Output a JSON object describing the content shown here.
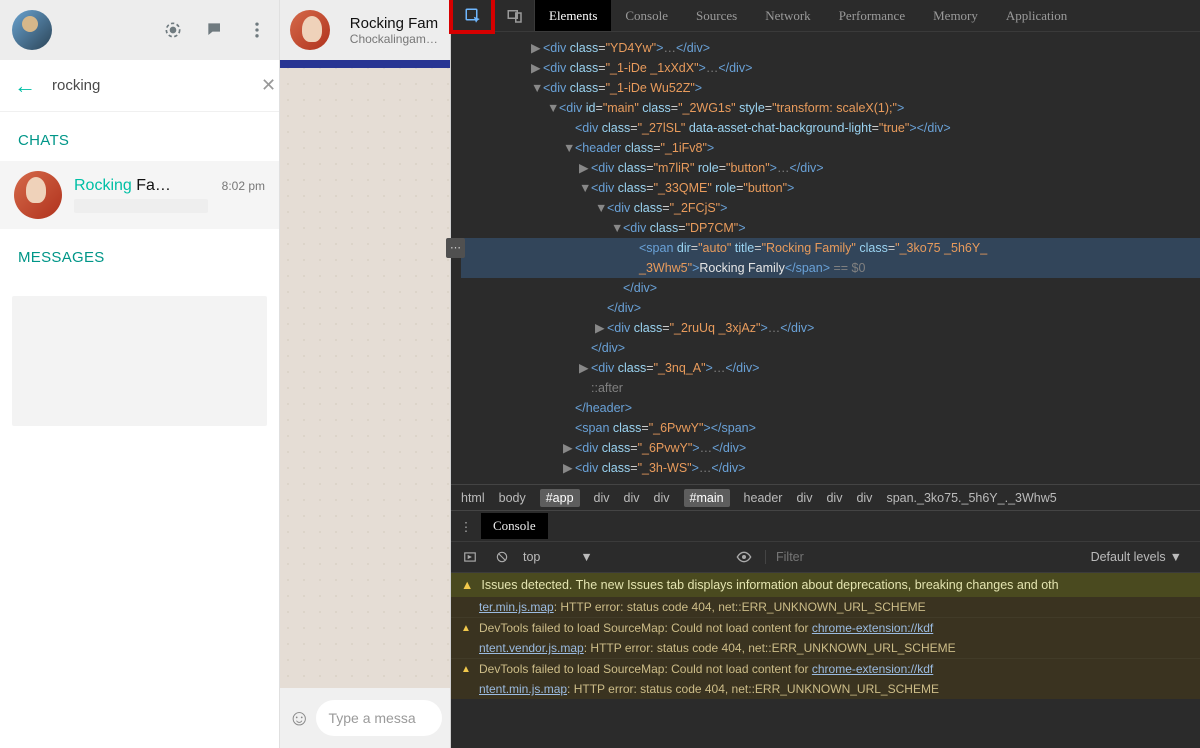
{
  "wa": {
    "search_value": "rocking",
    "section_chats": "CHATS",
    "section_messages": "MESSAGES",
    "chat": {
      "name_hl": "Rocking",
      "name_rest": " Fa…",
      "time": "8:02 pm"
    },
    "main": {
      "title": "Rocking Fam",
      "subtitle": "Chockalingam, B",
      "input_placeholder": "Type a messa"
    }
  },
  "dt": {
    "tabs": [
      "Elements",
      "Console",
      "Sources",
      "Network",
      "Performance",
      "Memory",
      "Application"
    ],
    "active_tab": "Elements",
    "dom": {
      "l1": "▶<div class=\"YD4Yw\">…</div>",
      "l2": "▶<div class=\"_1-iDe _1xXdX\">…</div>",
      "l3": "▼<div class=\"_1-iDe Wu52Z\">",
      "l4": "▼<div id=\"main\" class=\"_2WG1s\" style=\"transform: scaleX(1);\">",
      "l5": "<div class=\"_27lSL\" data-asset-chat-background-light=\"true\"></div>",
      "l6": "▼<header class=\"_1iFv8\">",
      "l7": "▶<div class=\"m7liR\" role=\"button\">…</div>",
      "l8": "▼<div class=\"_33QME\" role=\"button\">",
      "l9": "▼<div class=\"_2FCjS\">",
      "l10": "▼<div class=\"DP7CM\">",
      "l11a": "<span dir=\"auto\" title=\"Rocking Family\" class=\"_3ko75 _5h6Y_",
      "l11b": "_3Whw5\">",
      "l11c": "Rocking Family",
      "l11d": "</span>",
      "l11e": " == $0",
      "l12": "</div>",
      "l13": "</div>",
      "l14": "▶<div class=\"_2ruUq _3xjAz\">…</div>",
      "l15": "</div>",
      "l16": "▶<div class=\"_3nq_A\">…</div>",
      "l17": "::after",
      "l18": "</header>",
      "l19": "<span class=\"_6PvwY\"></span>",
      "l20": "▶<div class=\"_6PvwY\">…</div>",
      "l21": "▶<div class=\"_3h-WS\">…</div>"
    },
    "breadcrumb": [
      "html",
      "body",
      "#app",
      "div",
      "div",
      "div",
      "#main",
      "header",
      "div",
      "div",
      "div",
      "span._3ko75._5h6Y_._3Whw5"
    ],
    "breadcrumb_selected": [
      2,
      6
    ],
    "console": {
      "tab": "Console",
      "context": "top",
      "filter_placeholder": "Filter",
      "levels": "Default levels",
      "issue_bar": "Issues detected. The new Issues tab displays information about deprecations, breaking changes and oth",
      "log1a": "ter.min.js.map",
      "log1b": ": HTTP error: status code 404, net::ERR_UNKNOWN_URL_SCHEME",
      "log2a": "DevTools failed to load SourceMap: Could not load content for ",
      "log2b": "chrome-extension://kdf",
      "log2c": "ntent.vendor.js.map",
      "log2d": ": HTTP error: status code 404, net::ERR_UNKNOWN_URL_SCHEME",
      "log3a": "DevTools failed to load SourceMap: Could not load content for ",
      "log3b": "chrome-extension://kdf",
      "log3c": "ntent.min.js.map",
      "log3d": ": HTTP error: status code 404, net::ERR_UNKNOWN_URL_SCHEME"
    }
  }
}
